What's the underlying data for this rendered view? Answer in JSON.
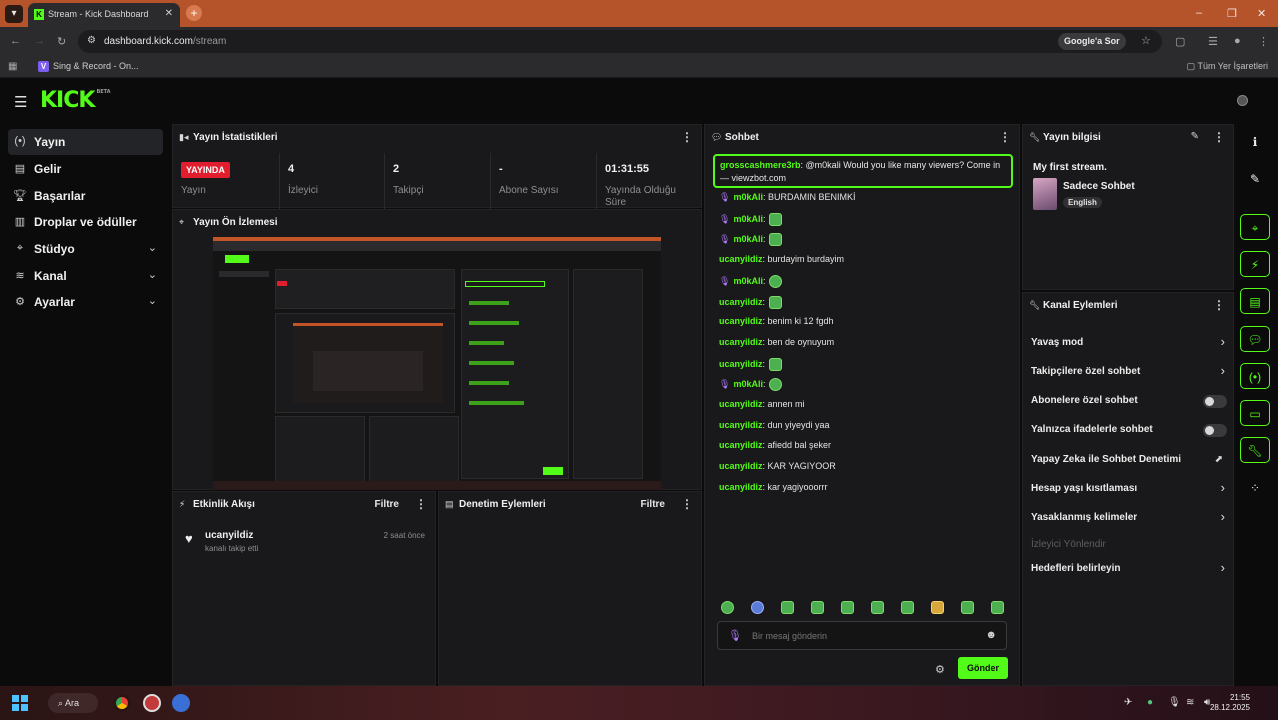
{
  "browser": {
    "tab_title": "Stream - Kick Dashboard",
    "url_domain": "dashboard.kick.com",
    "url_path": "/stream",
    "google_button": "Google'a Sor",
    "bookmark": "Sing & Record - On...",
    "all_bookmarks": "Tüm Yer İşaretleri"
  },
  "kick": {
    "logo": "KICK",
    "beta": "BETA"
  },
  "sidebar": {
    "items": [
      {
        "label": "Yayın",
        "icon": "broadcast-icon"
      },
      {
        "label": "Gelir",
        "icon": "income-icon"
      },
      {
        "label": "Başarılar",
        "icon": "trophy-icon"
      },
      {
        "label": "Droplar ve ödüller",
        "icon": "drops-icon"
      },
      {
        "label": "Stüdyo",
        "icon": "studio-icon"
      },
      {
        "label": "Kanal",
        "icon": "channel-icon"
      },
      {
        "label": "Ayarlar",
        "icon": "gear-icon"
      }
    ]
  },
  "stats": {
    "title": "Yayın İstatistikleri",
    "live_badge": "YAYINDA",
    "items": [
      {
        "value": "",
        "label": "Yayın"
      },
      {
        "value": "4",
        "label": "İzleyici"
      },
      {
        "value": "2",
        "label": "Takipçi"
      },
      {
        "value": "-",
        "label": "Abone Sayısı"
      },
      {
        "value": "01:31:55",
        "label": "Yayında Olduğu Süre"
      }
    ]
  },
  "preview": {
    "title": "Yayın Ön İzlemesi"
  },
  "activity": {
    "title": "Etkinlik Akışı",
    "filter": "Filtre",
    "event_user": "ucanyildiz",
    "event_desc": "kanalı takip etti",
    "event_time": "2 saat önce"
  },
  "moderation": {
    "title": "Denetim Eylemleri",
    "filter": "Filtre"
  },
  "chat": {
    "title": "Sohbet",
    "pinned_user": "grosscashmere3rb",
    "pinned_text": ": @m0kali Would you like many viewers? Come in — viewzbot.com",
    "messages": [
      {
        "user": "m0kAli",
        "text": ": BURDAMIN BENIMKİ",
        "mic": true,
        "emote": ""
      },
      {
        "user": "m0kAli",
        "text": ":",
        "mic": true,
        "emote": "green"
      },
      {
        "user": "m0kAli",
        "text": ":",
        "mic": true,
        "emote": "green"
      },
      {
        "user": "ucanyildiz",
        "text": ": burdayim burdayim",
        "mic": false,
        "emote": ""
      },
      {
        "user": "m0kAli",
        "text": ":",
        "mic": true,
        "emote": "round"
      },
      {
        "user": "ucanyildiz",
        "text": ":",
        "mic": false,
        "emote": "green"
      },
      {
        "user": "ucanyildiz",
        "text": ": benim ki 12 fgdh",
        "mic": false,
        "emote": ""
      },
      {
        "user": "ucanyildiz",
        "text": ": ben de oynuyum",
        "mic": false,
        "emote": ""
      },
      {
        "user": "ucanyildiz",
        "text": ":",
        "mic": false,
        "emote": "green"
      },
      {
        "user": "m0kAli",
        "text": ":",
        "mic": true,
        "emote": "round"
      },
      {
        "user": "ucanyildiz",
        "text": ": annen mi",
        "mic": false,
        "emote": ""
      },
      {
        "user": "ucanyildiz",
        "text": ": dun yiyeydi yaa",
        "mic": false,
        "emote": ""
      },
      {
        "user": "ucanyildiz",
        "text": ": afiedd bal şeker",
        "mic": false,
        "emote": ""
      },
      {
        "user": "ucanyildiz",
        "text": ": KAR YAGIYOOR",
        "mic": false,
        "emote": ""
      },
      {
        "user": "ucanyildiz",
        "text": ": kar yagiyooorrr",
        "mic": false,
        "emote": ""
      }
    ],
    "input_placeholder": "Bir mesaj gönderin",
    "send_button": "Gönder"
  },
  "stream_info": {
    "title": "Yayın bilgisi",
    "stream_title": "My first stream.",
    "category": "Sadece Sohbet",
    "language": "English"
  },
  "channel_actions": {
    "title": "Kanal Eylemleri",
    "items": [
      {
        "label": "Yavaş mod",
        "control": "chevron"
      },
      {
        "label": "Takipçilere özel sohbet",
        "control": "chevron"
      },
      {
        "label": "Abonelere özel sohbet",
        "control": "toggle"
      },
      {
        "label": "Yalnızca ifadelerle sohbet",
        "control": "toggle"
      },
      {
        "label": "Yapay Zeka ile Sohbet Denetimi",
        "control": "chart"
      },
      {
        "label": "Hesap yaşı kısıtlaması",
        "control": "chevron"
      },
      {
        "label": "Yasaklanmış kelimeler",
        "control": "chevron"
      },
      {
        "label": "İzleyici Yönlendir",
        "control": "disabled"
      },
      {
        "label": "Hedefleri belirleyin",
        "control": "chevron"
      }
    ]
  },
  "taskbar": {
    "search": "Ara",
    "time": "21:55",
    "date": "28.12.2025"
  },
  "colors": {
    "accent": "#53fc18",
    "live": "#e11d2e",
    "panel": "#19191b"
  }
}
